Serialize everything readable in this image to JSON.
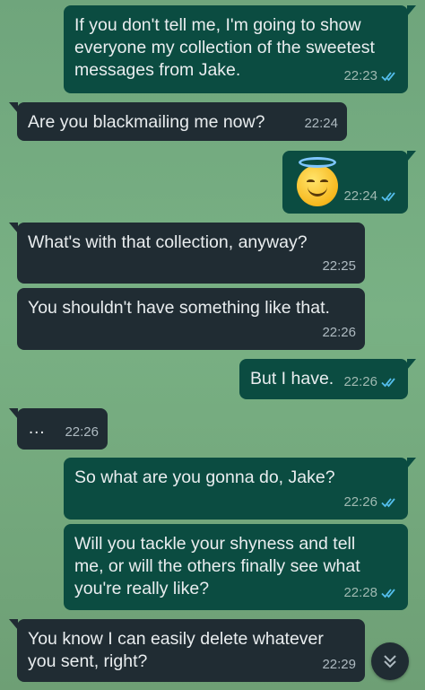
{
  "messages": [
    {
      "direction": "out",
      "text": "If you don't tell me, I'm going to show\neveryone my collection of the sweetest\nmessages from Jake.",
      "time": "22:23",
      "status": "read"
    },
    {
      "direction": "in",
      "text": "Are you blackmailing me now?",
      "time": "22:24"
    },
    {
      "direction": "out",
      "emoji": "smiling-face-with-halo",
      "time": "22:24",
      "status": "read"
    },
    {
      "direction": "in",
      "text": "What's with that collection, anyway?",
      "time": "22:25"
    },
    {
      "direction": "in",
      "text": "You shouldn't have something like that.",
      "time": "22:26"
    },
    {
      "direction": "out",
      "text": "But I have.",
      "time": "22:26",
      "status": "read"
    },
    {
      "direction": "in",
      "text": "…",
      "time": "22:26"
    },
    {
      "direction": "out",
      "text": "So what are you gonna do, Jake?",
      "time": "22:26",
      "status": "read"
    },
    {
      "direction": "out",
      "text": "Will you tackle your shyness and tell\nme, or will the others finally see what\nyou're really like?",
      "time": "22:28",
      "status": "read"
    },
    {
      "direction": "in",
      "text": "You know I can easily delete whatever\nyou sent, right?",
      "time": "22:29"
    }
  ],
  "scroll_button": {
    "icon": "double-chevron-down-icon"
  },
  "colors": {
    "outgoing_bubble": "#0b4c41",
    "incoming_bubble": "#202c33",
    "read_ticks": "#53bdeb",
    "background": "#76ab80"
  }
}
